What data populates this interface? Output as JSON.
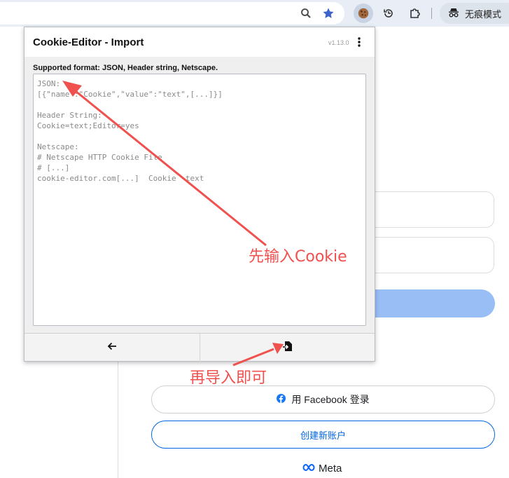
{
  "browser": {
    "incognito_label": "无痕模式",
    "icons": [
      "zoom-icon",
      "bookmark-star-icon",
      "cookie-extension-icon",
      "history-icon",
      "extensions-puzzle-icon",
      "incognito-icon"
    ]
  },
  "popup": {
    "title": "Cookie-Editor - Import",
    "version": "v1.13.0",
    "supported_format": "Supported format: JSON, Header string, Netscape.",
    "textarea_placeholder": "JSON:\n[{\"name\":\"Cookie\",\"value\":\"text\",[...]}]\n\nHeader String:\nCookie=text;Editor=yes\n\nNetscape:\n# Netscape HTTP Cookie File\n# [...]\ncookie-editor.com[...]  Cookie  text",
    "footer": {
      "back_icon": "arrow-left-icon",
      "import_icon": "import-file-icon"
    }
  },
  "background_page": {
    "facebook_login_label": "用 Facebook 登录",
    "create_account_label": "创建新账户",
    "meta_label": "Meta"
  },
  "annotations": {
    "step1": "先输入Cookie",
    "step2": "再导入即可",
    "color": "#f0514f"
  }
}
